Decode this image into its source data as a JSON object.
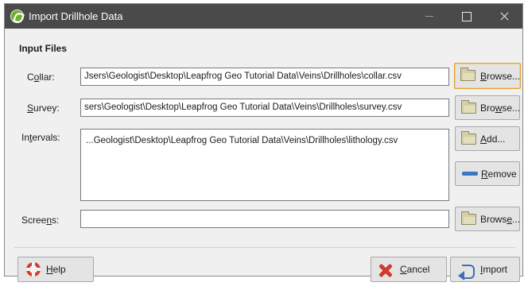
{
  "window": {
    "title": "Import Drillhole Data"
  },
  "section": {
    "title": "Input Files"
  },
  "collar": {
    "label_pre": "C",
    "label_ul": "o",
    "label_post": "llar:",
    "value": "Jsers\\Geologist\\Desktop\\Leapfrog Geo Tutorial Data\\Veins\\Drillholes\\collar.csv",
    "button": {
      "pre": "",
      "ul": "B",
      "post": "rowse..."
    }
  },
  "survey": {
    "label_pre": "",
    "label_ul": "S",
    "label_post": "urvey:",
    "value": "sers\\Geologist\\Desktop\\Leapfrog Geo Tutorial Data\\Veins\\Drillholes\\survey.csv",
    "button": {
      "pre": "Bro",
      "ul": "w",
      "post": "se..."
    }
  },
  "intervals": {
    "label_pre": "In",
    "label_ul": "t",
    "label_post": "ervals:",
    "items": [
      "...Geologist\\Desktop\\Leapfrog Geo Tutorial Data\\Veins\\Drillholes\\lithology.csv"
    ],
    "add_button": {
      "pre": "",
      "ul": "A",
      "post": "dd..."
    },
    "remove_button": {
      "pre": "",
      "ul": "R",
      "post": "emove"
    }
  },
  "screens": {
    "label_pre": "Scree",
    "label_ul": "n",
    "label_post": "s:",
    "value": "",
    "button": {
      "pre": "Brows",
      "ul": "e",
      "post": "..."
    }
  },
  "footer": {
    "help": {
      "pre": "",
      "ul": "H",
      "post": "elp"
    },
    "cancel": {
      "pre": "",
      "ul": "C",
      "post": "ancel"
    },
    "import": {
      "pre": "",
      "ul": "I",
      "post": "mport"
    }
  },
  "icons": {
    "app": "leapfrog-app-icon",
    "browse": "folder-icon",
    "remove": "remove-icon",
    "help": "help-lifebuoy-icon",
    "cancel": "cancel-x-icon",
    "import": "import-arrow-icon"
  },
  "colors": {
    "titlebar": "#4a4a4a",
    "focus_border": "#e0a030",
    "window_bg": "#f0f0f0"
  }
}
